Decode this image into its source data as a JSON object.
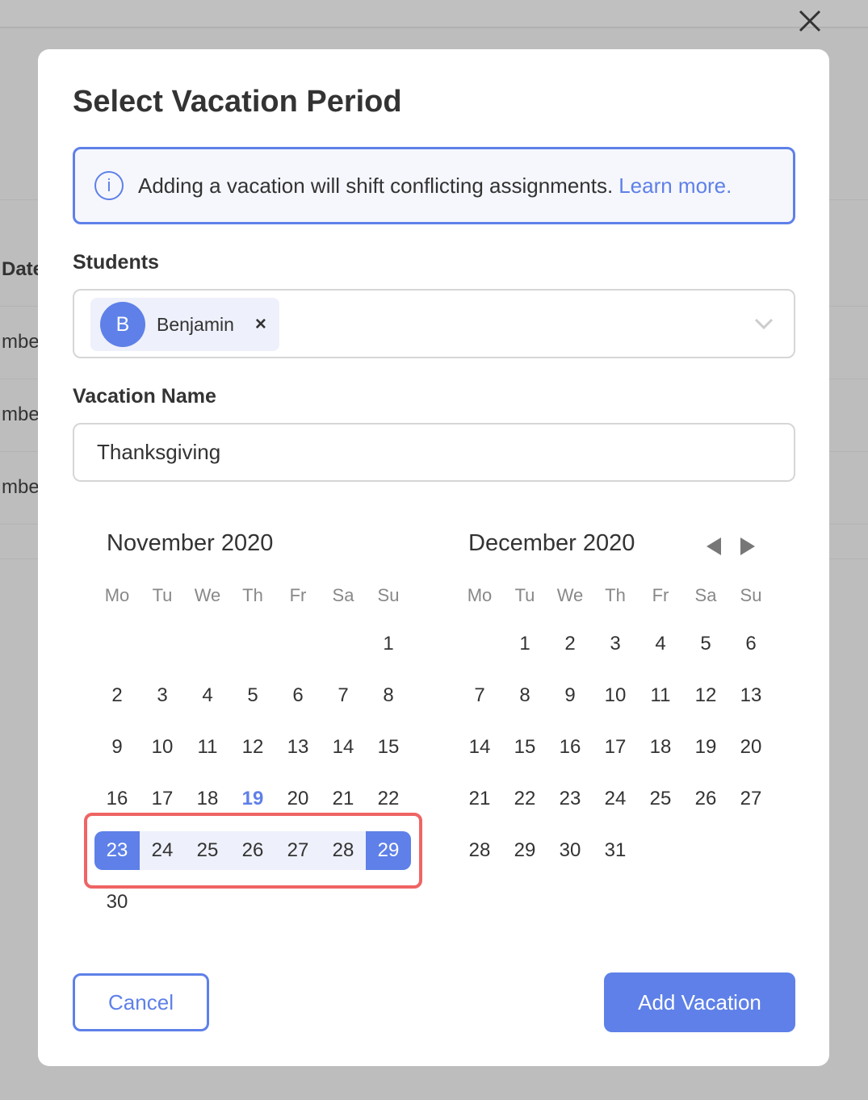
{
  "background": {
    "fragments": [
      "Date",
      "mbe",
      "mbe",
      "mbe"
    ]
  },
  "modal": {
    "title": "Select Vacation Period",
    "info": {
      "text": "Adding a vacation will shift conflicting assignments.",
      "link": "Learn more.",
      "icon": "info-icon"
    },
    "students": {
      "label": "Students",
      "chips": [
        {
          "initial": "B",
          "name": "Benjamin",
          "remove": "×"
        }
      ]
    },
    "vacation_name": {
      "label": "Vacation Name",
      "value": "Thanksgiving"
    },
    "calendar": {
      "weekdays": [
        "Mo",
        "Tu",
        "We",
        "Th",
        "Fr",
        "Sa",
        "Su"
      ],
      "today": {
        "month": 0,
        "day": 19
      },
      "selection": {
        "month": 0,
        "start": 23,
        "end": 29
      },
      "months": [
        {
          "title": "November 2020",
          "offset": 6,
          "days": 30
        },
        {
          "title": "December 2020",
          "offset": 1,
          "days": 31
        }
      ]
    },
    "cancel_label": "Cancel",
    "add_label": "Add Vacation"
  },
  "colors": {
    "accent": "#5e80e8",
    "range": "#eef0fb",
    "highlight": "#ef6464"
  }
}
